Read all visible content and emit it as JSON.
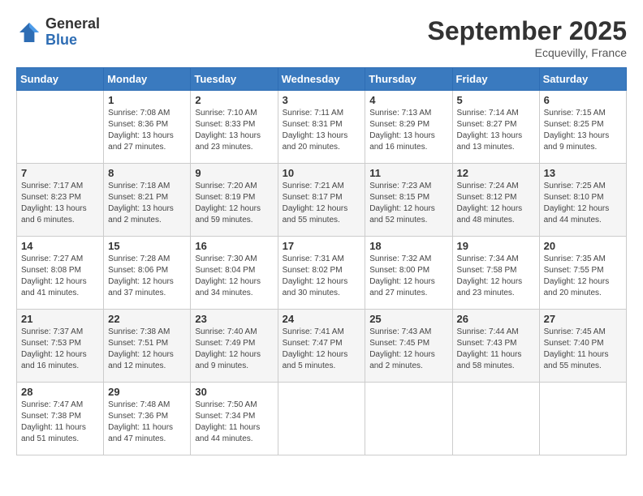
{
  "header": {
    "logo_general": "General",
    "logo_blue": "Blue",
    "month_title": "September 2025",
    "location": "Ecquevilly, France"
  },
  "columns": [
    "Sunday",
    "Monday",
    "Tuesday",
    "Wednesday",
    "Thursday",
    "Friday",
    "Saturday"
  ],
  "weeks": [
    [
      {
        "day": "",
        "info": ""
      },
      {
        "day": "1",
        "info": "Sunrise: 7:08 AM\nSunset: 8:36 PM\nDaylight: 13 hours\nand 27 minutes."
      },
      {
        "day": "2",
        "info": "Sunrise: 7:10 AM\nSunset: 8:33 PM\nDaylight: 13 hours\nand 23 minutes."
      },
      {
        "day": "3",
        "info": "Sunrise: 7:11 AM\nSunset: 8:31 PM\nDaylight: 13 hours\nand 20 minutes."
      },
      {
        "day": "4",
        "info": "Sunrise: 7:13 AM\nSunset: 8:29 PM\nDaylight: 13 hours\nand 16 minutes."
      },
      {
        "day": "5",
        "info": "Sunrise: 7:14 AM\nSunset: 8:27 PM\nDaylight: 13 hours\nand 13 minutes."
      },
      {
        "day": "6",
        "info": "Sunrise: 7:15 AM\nSunset: 8:25 PM\nDaylight: 13 hours\nand 9 minutes."
      }
    ],
    [
      {
        "day": "7",
        "info": "Sunrise: 7:17 AM\nSunset: 8:23 PM\nDaylight: 13 hours\nand 6 minutes."
      },
      {
        "day": "8",
        "info": "Sunrise: 7:18 AM\nSunset: 8:21 PM\nDaylight: 13 hours\nand 2 minutes."
      },
      {
        "day": "9",
        "info": "Sunrise: 7:20 AM\nSunset: 8:19 PM\nDaylight: 12 hours\nand 59 minutes."
      },
      {
        "day": "10",
        "info": "Sunrise: 7:21 AM\nSunset: 8:17 PM\nDaylight: 12 hours\nand 55 minutes."
      },
      {
        "day": "11",
        "info": "Sunrise: 7:23 AM\nSunset: 8:15 PM\nDaylight: 12 hours\nand 52 minutes."
      },
      {
        "day": "12",
        "info": "Sunrise: 7:24 AM\nSunset: 8:12 PM\nDaylight: 12 hours\nand 48 minutes."
      },
      {
        "day": "13",
        "info": "Sunrise: 7:25 AM\nSunset: 8:10 PM\nDaylight: 12 hours\nand 44 minutes."
      }
    ],
    [
      {
        "day": "14",
        "info": "Sunrise: 7:27 AM\nSunset: 8:08 PM\nDaylight: 12 hours\nand 41 minutes."
      },
      {
        "day": "15",
        "info": "Sunrise: 7:28 AM\nSunset: 8:06 PM\nDaylight: 12 hours\nand 37 minutes."
      },
      {
        "day": "16",
        "info": "Sunrise: 7:30 AM\nSunset: 8:04 PM\nDaylight: 12 hours\nand 34 minutes."
      },
      {
        "day": "17",
        "info": "Sunrise: 7:31 AM\nSunset: 8:02 PM\nDaylight: 12 hours\nand 30 minutes."
      },
      {
        "day": "18",
        "info": "Sunrise: 7:32 AM\nSunset: 8:00 PM\nDaylight: 12 hours\nand 27 minutes."
      },
      {
        "day": "19",
        "info": "Sunrise: 7:34 AM\nSunset: 7:58 PM\nDaylight: 12 hours\nand 23 minutes."
      },
      {
        "day": "20",
        "info": "Sunrise: 7:35 AM\nSunset: 7:55 PM\nDaylight: 12 hours\nand 20 minutes."
      }
    ],
    [
      {
        "day": "21",
        "info": "Sunrise: 7:37 AM\nSunset: 7:53 PM\nDaylight: 12 hours\nand 16 minutes."
      },
      {
        "day": "22",
        "info": "Sunrise: 7:38 AM\nSunset: 7:51 PM\nDaylight: 12 hours\nand 12 minutes."
      },
      {
        "day": "23",
        "info": "Sunrise: 7:40 AM\nSunset: 7:49 PM\nDaylight: 12 hours\nand 9 minutes."
      },
      {
        "day": "24",
        "info": "Sunrise: 7:41 AM\nSunset: 7:47 PM\nDaylight: 12 hours\nand 5 minutes."
      },
      {
        "day": "25",
        "info": "Sunrise: 7:43 AM\nSunset: 7:45 PM\nDaylight: 12 hours\nand 2 minutes."
      },
      {
        "day": "26",
        "info": "Sunrise: 7:44 AM\nSunset: 7:43 PM\nDaylight: 11 hours\nand 58 minutes."
      },
      {
        "day": "27",
        "info": "Sunrise: 7:45 AM\nSunset: 7:40 PM\nDaylight: 11 hours\nand 55 minutes."
      }
    ],
    [
      {
        "day": "28",
        "info": "Sunrise: 7:47 AM\nSunset: 7:38 PM\nDaylight: 11 hours\nand 51 minutes."
      },
      {
        "day": "29",
        "info": "Sunrise: 7:48 AM\nSunset: 7:36 PM\nDaylight: 11 hours\nand 47 minutes."
      },
      {
        "day": "30",
        "info": "Sunrise: 7:50 AM\nSunset: 7:34 PM\nDaylight: 11 hours\nand 44 minutes."
      },
      {
        "day": "",
        "info": ""
      },
      {
        "day": "",
        "info": ""
      },
      {
        "day": "",
        "info": ""
      },
      {
        "day": "",
        "info": ""
      }
    ]
  ]
}
